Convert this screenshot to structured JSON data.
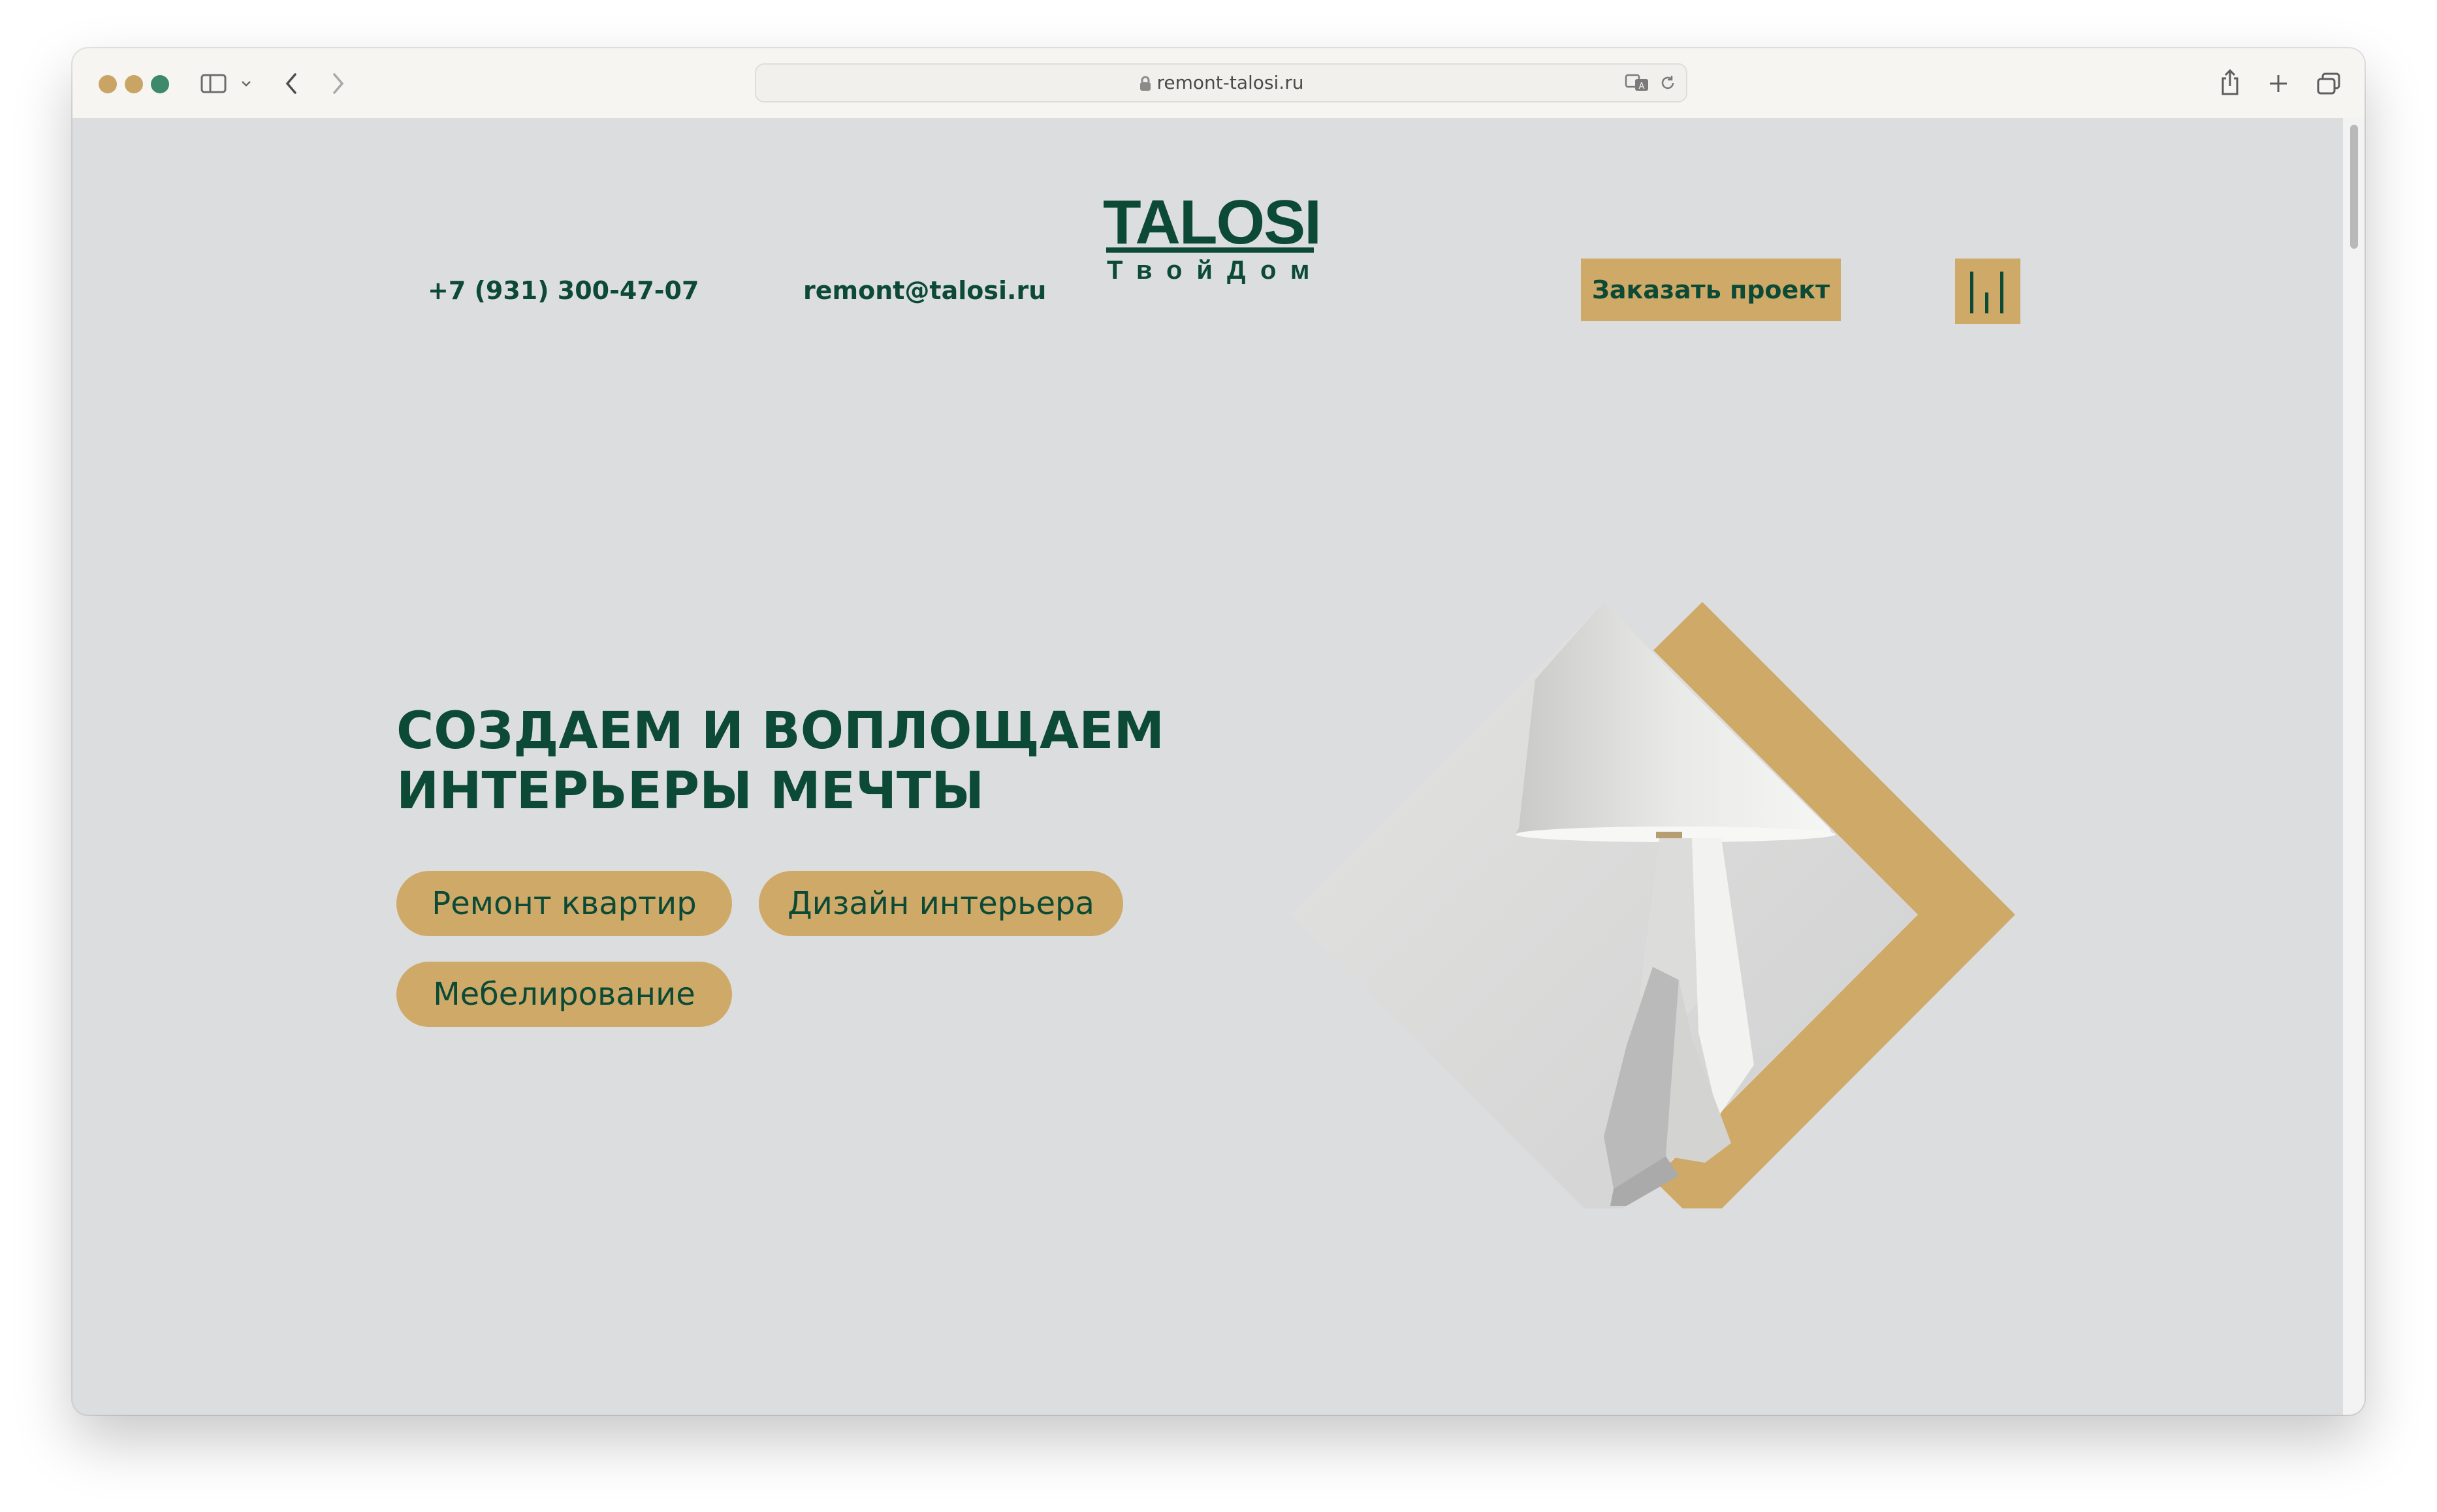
{
  "browser": {
    "url": "remont-talosi.ru",
    "icons": [
      "close-light",
      "minimize-light",
      "zoom-light",
      "sidebar-icon",
      "chevron-down-icon",
      "back-icon",
      "forward-icon",
      "lock-icon",
      "translate-icon",
      "reload-icon",
      "share-icon",
      "plus-icon",
      "tabs-icon"
    ]
  },
  "header": {
    "phone": "+7 (931) 300-47-07",
    "email": "remont@talosi.ru",
    "logo_title": "TALOSI",
    "logo_subtitle": "ТвойДом",
    "order_button": "Заказать проект",
    "menu_icon": "menu-bars-icon"
  },
  "hero": {
    "title_line1": "СОЗДАЕМ И ВОПЛОЩАЕМ",
    "title_line2": "ИНТЕРЬЕРЫ МЕЧТЫ",
    "services": [
      "Ремонт квартир",
      "Дизайн интерьера",
      "Мебелирование"
    ],
    "image": "lamp-illustration"
  },
  "colors": {
    "brand_green": "#0c4a36",
    "accent_gold": "#cfa967",
    "page_background": "#dcdddf"
  }
}
